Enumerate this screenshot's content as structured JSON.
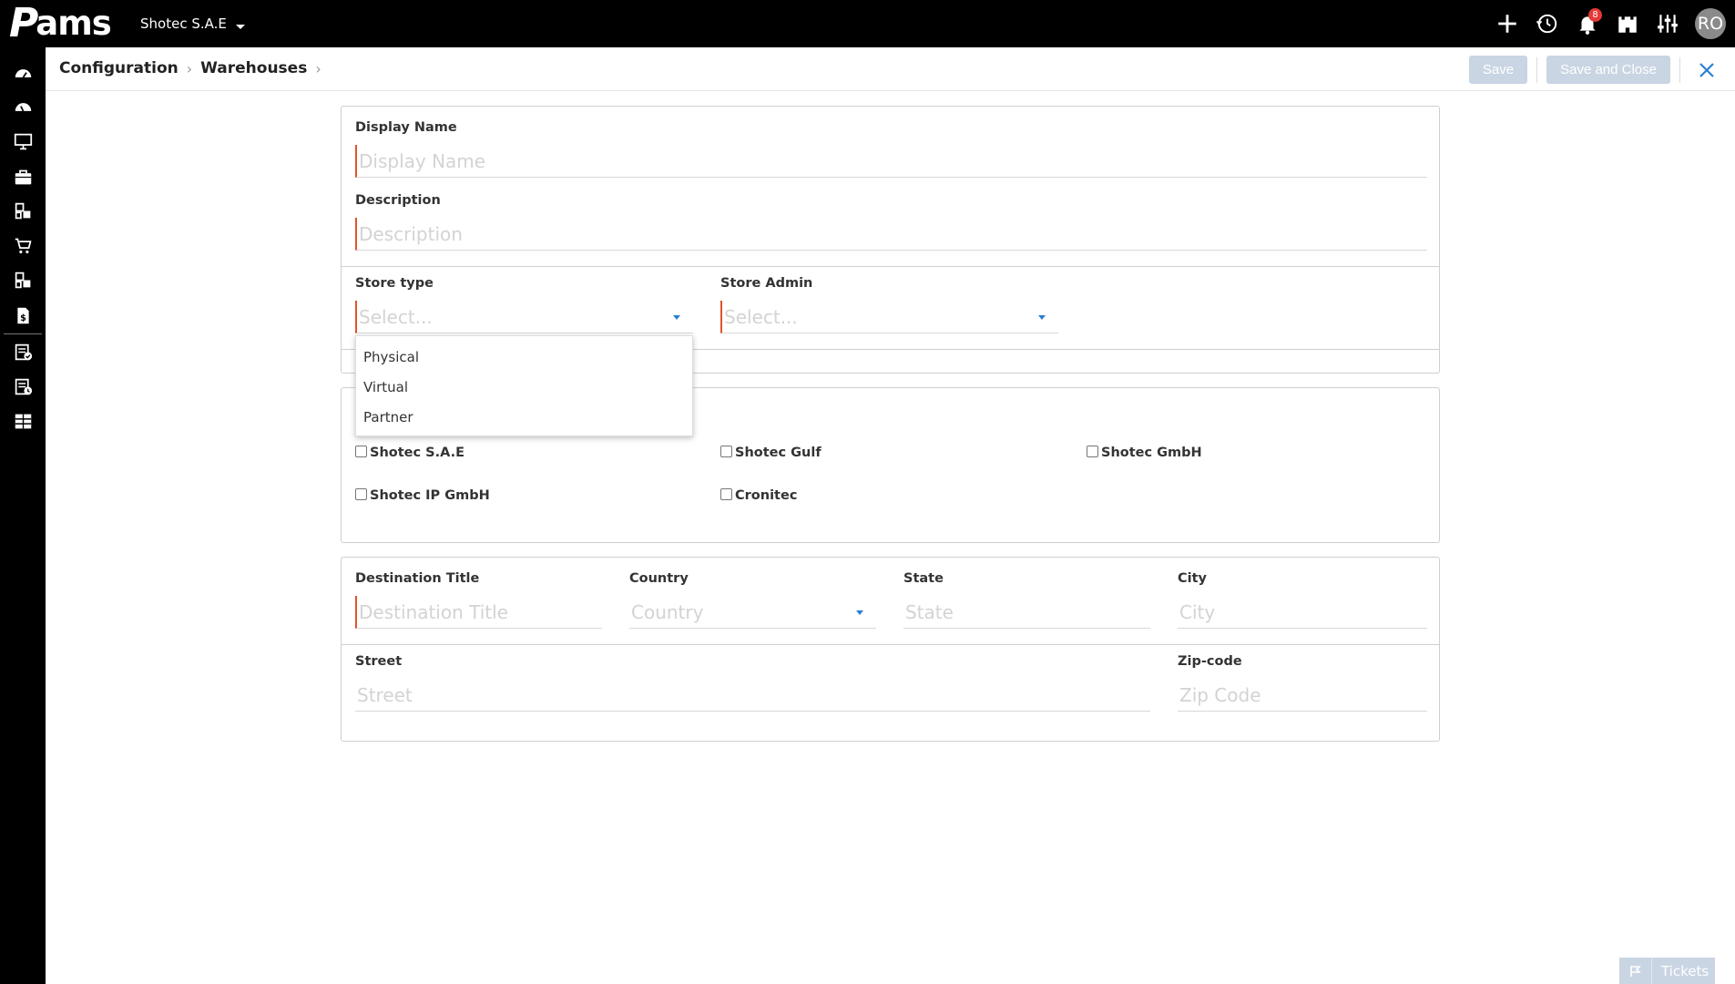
{
  "app": {
    "logo_text": "ams",
    "company": "Shotec S.A.E"
  },
  "topbar": {
    "notification_count": "8",
    "avatar_initials": "RO"
  },
  "breadcrumb": {
    "items": [
      "Configuration",
      "Warehouses"
    ]
  },
  "actions": {
    "save": "Save",
    "save_close": "Save and Close"
  },
  "form": {
    "display_name_label": "Display Name",
    "display_name_placeholder": "Display Name",
    "description_label": "Description",
    "description_placeholder": "Description",
    "store_type_label": "Store type",
    "store_type_placeholder": "Select...",
    "store_admin_label": "Store Admin",
    "store_admin_placeholder": "Select...",
    "store_type_options": [
      "Physical",
      "Virtual",
      "Partner"
    ],
    "companies": [
      "Shotec S.A.E",
      "Shotec Gulf",
      "Shotec GmbH",
      "Shotec IP GmbH",
      "Cronitec"
    ],
    "destination_title_label": "Destination Title",
    "destination_title_placeholder": "Destination Title",
    "country_label": "Country",
    "country_placeholder": "Country",
    "state_label": "State",
    "state_placeholder": "State",
    "city_label": "City",
    "city_placeholder": "City",
    "street_label": "Street",
    "street_placeholder": "Street",
    "zip_label": "Zip-code",
    "zip_placeholder": "Zip Code"
  },
  "tickets": {
    "label": "Tickets"
  }
}
